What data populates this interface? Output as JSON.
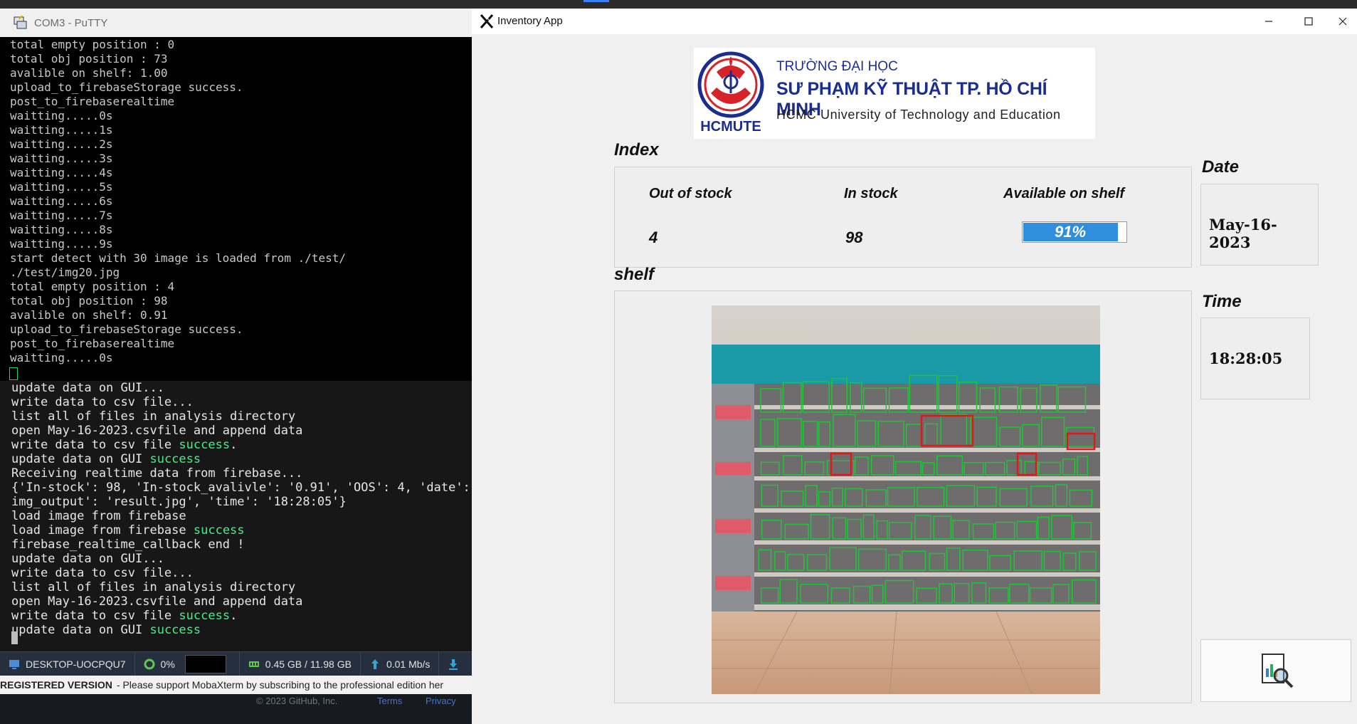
{
  "putty": {
    "title": "COM3 - PuTTY",
    "lines": [
      "total empty position : 0",
      "total obj position : 73",
      "avalible on shelf: 1.00",
      "upload_to_firebaseStorage success.",
      "post_to_firebaserealtime",
      "waitting.....0s",
      "waitting.....1s",
      "waitting.....2s",
      "waitting.....3s",
      "waitting.....4s",
      "waitting.....5s",
      "waitting.....6s",
      "waitting.....7s",
      "waitting.....8s",
      "waitting.....9s",
      "start detect with 30 image is loaded from ./test/",
      "./test/img20.jpg",
      "total empty position : 4",
      "total obj position : 98",
      "avalible on shelf: 0.91",
      "upload_to_firebaseStorage success.",
      "post_to_firebaserealtime",
      "waitting.....0s"
    ]
  },
  "moba": {
    "lines": [
      {
        "text": "update data on GUI...",
        "ok": ""
      },
      {
        "text": "write data to csv file...",
        "ok": ""
      },
      {
        "text": "list all of files in analysis directory",
        "ok": ""
      },
      {
        "text": "open May-16-2023.csvfile and append data",
        "ok": ""
      },
      {
        "text": "write data to csv file ",
        "ok": "success",
        "tail": "."
      },
      {
        "text": "update data on GUI ",
        "ok": "success"
      },
      {
        "text": "Receiving realtime data from firebase...",
        "ok": ""
      },
      {
        "text": "{'In-stock': 98, 'In-stock_avalivle': '0.91', 'OOS': 4, 'date': '",
        "ok": ""
      },
      {
        "text": "img_output': 'result.jpg', 'time': '18:28:05'}",
        "ok": ""
      },
      {
        "text": "load image from firebase",
        "ok": ""
      },
      {
        "text": "load image from firebase ",
        "ok": "success"
      },
      {
        "text": "firebase_realtime_callback end !",
        "ok": ""
      },
      {
        "text": "update data on GUI...",
        "ok": ""
      },
      {
        "text": "write data to csv file...",
        "ok": ""
      },
      {
        "text": "list all of files in analysis directory",
        "ok": ""
      },
      {
        "text": "open May-16-2023.csvfile and append data",
        "ok": ""
      },
      {
        "text": "write data to csv file ",
        "ok": "success",
        "tail": "."
      },
      {
        "text": "update data on GUI ",
        "ok": "success"
      }
    ]
  },
  "statusbar": {
    "host": "DESKTOP-UOCPQU7",
    "cpu": "0%",
    "memory": "0.45 GB / 11.98 GB",
    "net": "0.01 Mb/s"
  },
  "regbar": {
    "bold": "REGISTERED VERSION",
    "text": " -  Please support MobaXterm by subscribing to the professional edition her"
  },
  "footer": {
    "copyright": "© 2023 GitHub, Inc.",
    "terms": "Terms",
    "privacy": "Privacy"
  },
  "app": {
    "title": "Inventory App",
    "banner": {
      "line1": "TRƯỜNG ĐẠI HỌC",
      "line2": "SƯ PHẠM KỸ THUẬT TP. HỒ CHÍ MINH",
      "line3": "HCMC University of Technology and Education",
      "abbr": "HCMUTE"
    },
    "index_label": "Index",
    "shelf_label": "shelf",
    "date_label": "Date",
    "time_label": "Time",
    "headers": {
      "out_of_stock": "Out of stock",
      "in_stock": "In stock",
      "available": "Available on shelf"
    },
    "values": {
      "out_of_stock": "4",
      "in_stock": "98",
      "available_text": "91%",
      "available_fraction": 0.91
    },
    "date": "May-16-2023",
    "time": "18:28:05",
    "report_button_icon": "report-analysis-icon"
  },
  "colors": {
    "progress": "#2f8fde",
    "success_text": "#42f08a",
    "brand_blue": "#1b2e8f",
    "detect_green": "#22c33a",
    "detect_red": "#e01818"
  }
}
